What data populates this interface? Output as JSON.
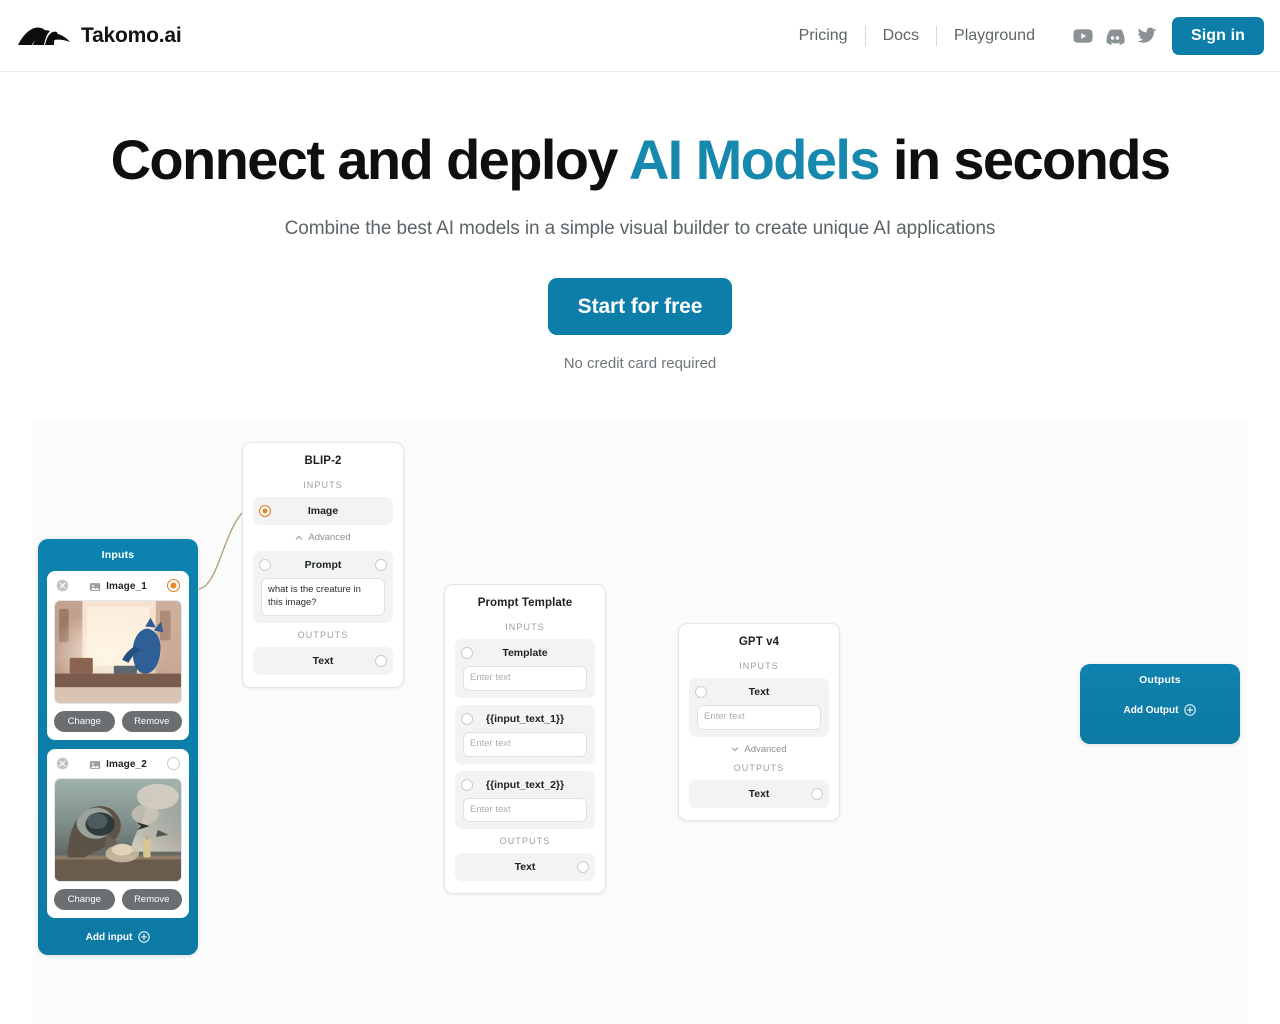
{
  "header": {
    "brand_name": "Takomo.ai",
    "brand_logo_icon": "takomo-logo-icon",
    "nav": [
      {
        "label": "Pricing"
      },
      {
        "label": "Docs"
      },
      {
        "label": "Playground"
      }
    ],
    "social": [
      {
        "icon": "youtube-icon",
        "name": "youtube"
      },
      {
        "icon": "discord-icon",
        "name": "discord"
      },
      {
        "icon": "twitter-icon",
        "name": "twitter"
      }
    ],
    "signin_label": "Sign in"
  },
  "hero": {
    "title_part1": "Connect and deploy ",
    "title_accent": "AI Models",
    "title_part2": " in seconds",
    "subtitle": "Combine the best AI models in a simple visual builder to create unique AI applications",
    "cta_label": "Start for free",
    "cta_note": "No credit card required",
    "accent_color": "#1789ae",
    "cta_color": "#0d7da9"
  },
  "flow": {
    "inputs_panel": {
      "title": "Inputs",
      "add_label": "Add input",
      "add_icon": "plus-circle-icon",
      "panel_color": "#0e82ae",
      "items": [
        {
          "name": "Image_1",
          "icon": "picture-icon",
          "remove_icon": "close-circle-icon",
          "port_active": true,
          "change_label": "Change",
          "remove_label": "Remove",
          "thumb_alt": "blue fox sitting at a desk in warm sunlit room"
        },
        {
          "name": "Image_2",
          "icon": "picture-icon",
          "remove_icon": "close-circle-icon",
          "port_active": false,
          "change_label": "Change",
          "remove_label": "Remove",
          "thumb_alt": "figure in helmet working with billowing smoke"
        }
      ]
    },
    "nodes": [
      {
        "id": "blip2",
        "title": "BLIP-2",
        "inputs_label": "INPUTS",
        "outputs_label": "OUTPUTS",
        "advanced_label": "Advanced",
        "advanced_icon": "chevron-up-icon",
        "ports_in": [
          {
            "name": "Image",
            "active": true,
            "has_field": false
          },
          {
            "name": "Prompt",
            "active": false,
            "has_field": true,
            "value": "what is the creature in this image?"
          }
        ],
        "ports_out": [
          {
            "name": "Text"
          }
        ]
      },
      {
        "id": "prompt-template",
        "title": "Prompt Template",
        "inputs_label": "INPUTS",
        "outputs_label": "OUTPUTS",
        "ports_in": [
          {
            "name": "Template",
            "active": false,
            "has_field": true,
            "placeholder": "Enter text"
          },
          {
            "name": "{{input_text_1}}",
            "active": false,
            "has_field": true,
            "placeholder": "Enter text"
          },
          {
            "name": "{{input_text_2}}",
            "active": false,
            "has_field": true,
            "placeholder": "Enter text"
          }
        ],
        "ports_out": [
          {
            "name": "Text"
          }
        ]
      },
      {
        "id": "gpt-v4",
        "title": "GPT v4",
        "inputs_label": "INPUTS",
        "outputs_label": "OUTPUTS",
        "advanced_label": "Advanced",
        "advanced_icon": "chevron-down-icon",
        "ports_in": [
          {
            "name": "Text",
            "active": false,
            "has_field": true,
            "placeholder": "Enter text"
          }
        ],
        "ports_out": [
          {
            "name": "Text"
          }
        ]
      }
    ],
    "outputs_panel": {
      "title": "Outputs",
      "add_label": "Add Output",
      "add_icon": "plus-circle-icon",
      "panel_color": "#0e82ae"
    },
    "edge_color": "#b3a17a"
  }
}
